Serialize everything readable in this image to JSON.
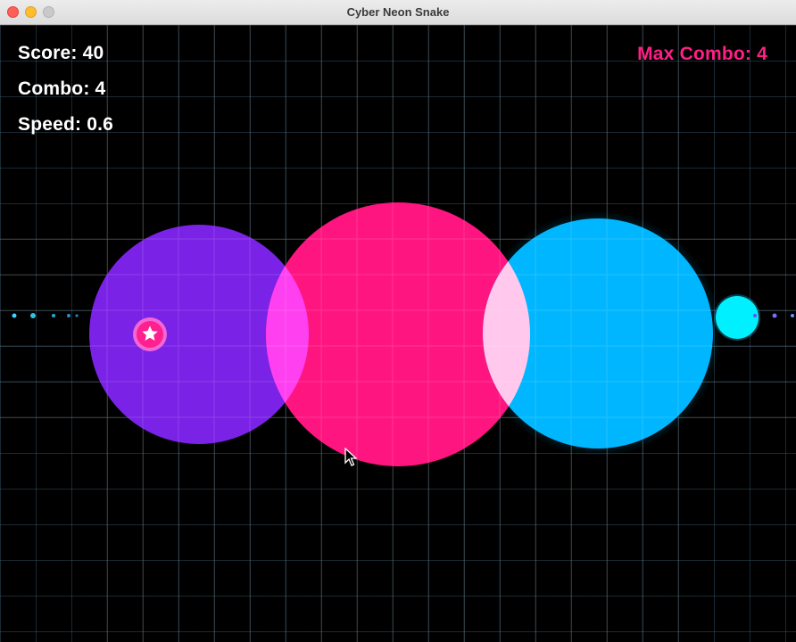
{
  "window": {
    "title": "Cyber Neon Snake"
  },
  "hud": {
    "score_label": "Score: 40",
    "combo_label": "Combo: 4",
    "speed_label": "Speed: 0.6",
    "max_combo_label": "Max Combo: 4"
  },
  "colors": {
    "background": "#000000",
    "grid": "#3c5a6e",
    "purple": "#7a22e6",
    "pink": "#ff1580",
    "blue": "#00b7ff",
    "cyan": "#00f0ff",
    "overlap_purple_pink": "#ff40f0",
    "overlap_pink_blue": "#ffc8ec",
    "max_combo_text": "#ff1f85",
    "hud_text": "#ffffff"
  },
  "icons": {
    "powerup": "star-icon",
    "pointer": "cursor-icon"
  }
}
